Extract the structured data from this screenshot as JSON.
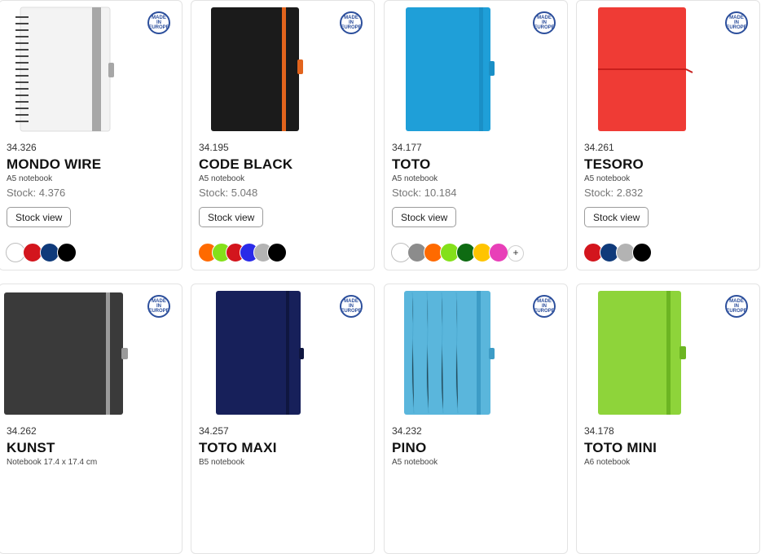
{
  "badge": {
    "line1": "MADE IN",
    "line2": "EUROPE"
  },
  "products": [
    {
      "sku": "34.326",
      "name": "MONDO WIRE",
      "type": "A5 notebook",
      "stock": "Stock: 4.376",
      "button": "Stock view",
      "cover": "#f4f4f4",
      "band": "#a7a7a7",
      "swatches": [
        "#ffffff",
        "#d3151d",
        "#0f3a7a",
        "#000000"
      ],
      "more": ""
    },
    {
      "sku": "34.195",
      "name": "CODE BLACK",
      "type": "A5 notebook",
      "stock": "Stock: 5.048",
      "button": "Stock view",
      "cover": "#1b1b1b",
      "band": "#e2641d",
      "swatches": [
        "#ff6a00",
        "#84e01a",
        "#d3151d",
        "#2a2ae8",
        "#b3b3b3",
        "#000000"
      ],
      "more": ""
    },
    {
      "sku": "34.177",
      "name": "TOTO",
      "type": "A5 notebook",
      "stock": "Stock: 10.184",
      "button": "Stock view",
      "cover": "#1f9fd8",
      "band": "#1a8fc6",
      "swatches": [
        "#ffffff",
        "#8c8c8c",
        "#ff6a00",
        "#84e01a",
        "#0e6b12",
        "#ffc400",
        "#e83fb8"
      ],
      "more": "+"
    },
    {
      "sku": "34.261",
      "name": "TESORO",
      "type": "A5 notebook",
      "stock": "Stock: 2.832",
      "button": "Stock view",
      "cover": "#ef3b35",
      "band": "#c81f1c",
      "swatches": [
        "#d3151d",
        "#0f3a7a",
        "#b3b3b3",
        "#000000"
      ],
      "more": ""
    },
    {
      "sku": "34.262",
      "name": "KUNST",
      "type": "Notebook 17.4 x 17.4 cm",
      "stock": "",
      "button": "",
      "cover": "#3a3a3a",
      "band": "#9a9a9a",
      "swatches": [],
      "more": ""
    },
    {
      "sku": "34.257",
      "name": "TOTO MAXI",
      "type": "B5 notebook",
      "stock": "",
      "button": "",
      "cover": "#17205a",
      "band": "#0f1640",
      "swatches": [],
      "more": ""
    },
    {
      "sku": "34.232",
      "name": "PINO",
      "type": "A5 notebook",
      "stock": "",
      "button": "",
      "cover": "#5ab6dc",
      "band": "#3d9cc6",
      "swatches": [],
      "more": ""
    },
    {
      "sku": "34.178",
      "name": "TOTO MINI",
      "type": "A6 notebook",
      "stock": "",
      "button": "",
      "cover": "#8ed43a",
      "band": "#6cb522",
      "swatches": [],
      "more": ""
    }
  ]
}
